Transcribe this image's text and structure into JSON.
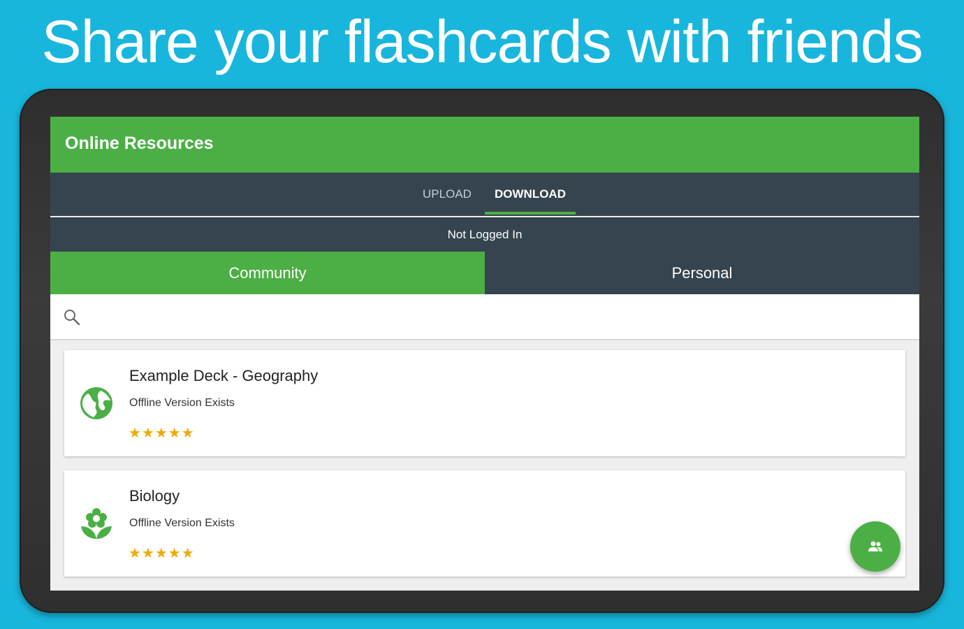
{
  "headline": "Share your flashcards with friends",
  "colors": {
    "background": "#18b6dc",
    "accent": "#4caf45",
    "dark_bar": "#35444e",
    "star": "#f2a900"
  },
  "app": {
    "title": "Online Resources",
    "tabs": [
      {
        "label": "UPLOAD",
        "selected": false
      },
      {
        "label": "DOWNLOAD",
        "selected": true
      }
    ],
    "login_status": "Not Logged In",
    "segments": [
      {
        "label": "Community",
        "selected": true
      },
      {
        "label": "Personal",
        "selected": false
      }
    ],
    "search": {
      "placeholder": "",
      "value": "",
      "icon": "search-icon"
    },
    "decks": [
      {
        "title": "Example Deck - Geography",
        "subtitle": "Offline Version Exists",
        "stars": "★★★★★",
        "rating": 5,
        "icon": "globe-icon"
      },
      {
        "title": "Biology",
        "subtitle": "Offline Version Exists",
        "stars": "★★★★★",
        "rating": 5,
        "icon": "flower-icon"
      }
    ],
    "fab": {
      "icon": "people-icon"
    }
  }
}
